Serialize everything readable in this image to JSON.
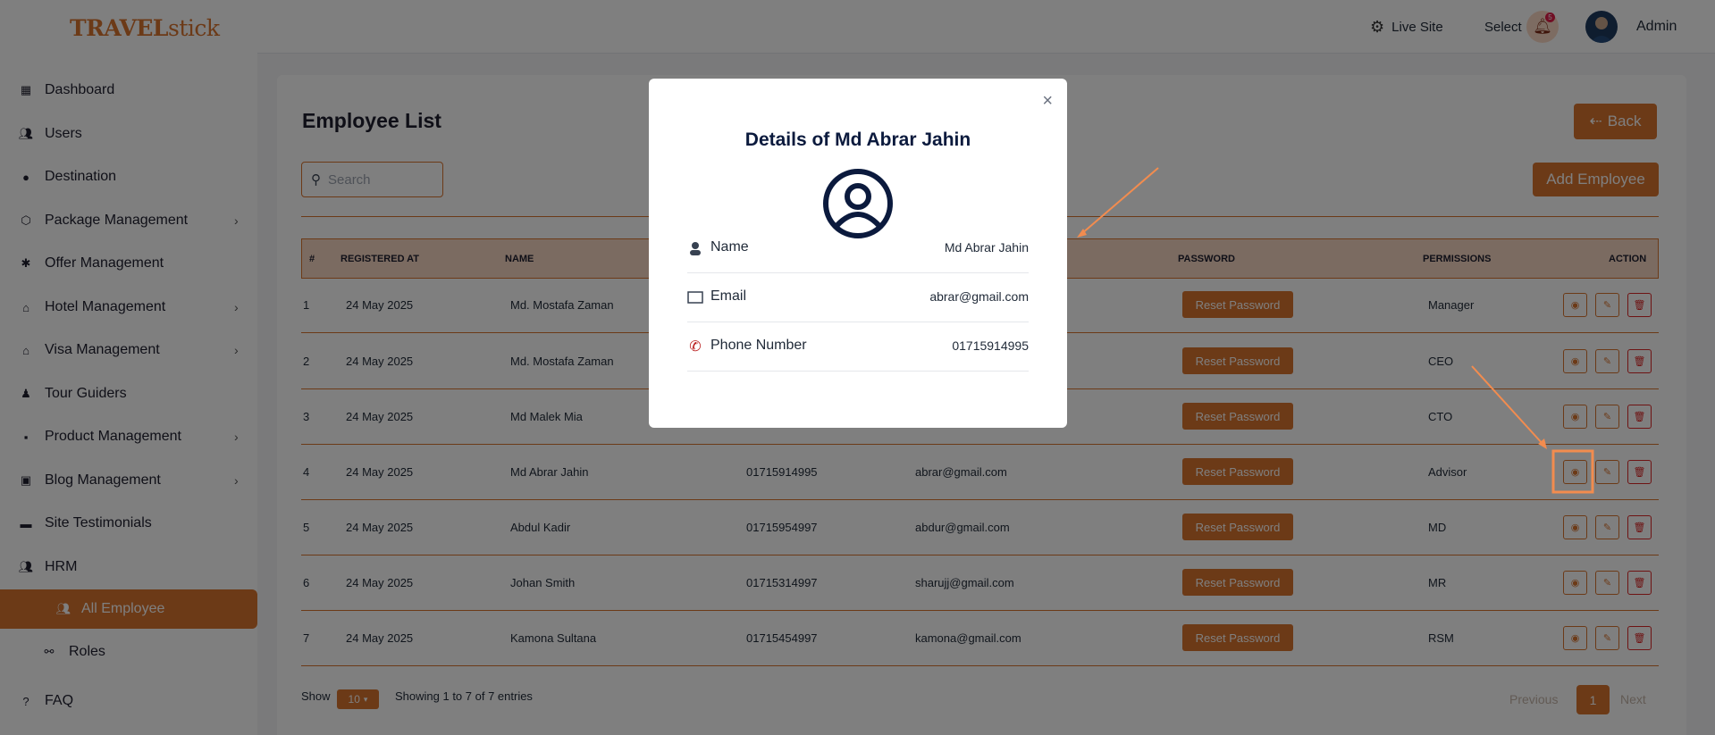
{
  "brand": {
    "logo_text": "TRAVEL",
    "logo_text2": "stick"
  },
  "sidebar": {
    "items": [
      {
        "label": "Dashboard",
        "icon": "dashboard-icon"
      },
      {
        "label": "Users",
        "icon": "users-icon"
      },
      {
        "label": "Destination",
        "icon": "location-icon"
      },
      {
        "label": "Package Management",
        "icon": "package-icon",
        "chevron": "›"
      },
      {
        "label": "Offer Management",
        "icon": "offer-icon"
      },
      {
        "label": "Hotel Management",
        "icon": "hotel-icon",
        "chevron": "›"
      },
      {
        "label": "Visa Management",
        "icon": "visa-icon",
        "chevron": "›"
      },
      {
        "label": "Tour Guiders",
        "icon": "guide-icon"
      },
      {
        "label": "Product Management",
        "icon": "product-icon",
        "chevron": "›"
      },
      {
        "label": "Blog Management",
        "icon": "blog-icon",
        "chevron": "›"
      },
      {
        "label": "Site Testimonials",
        "icon": "testimonial-icon"
      },
      {
        "label": "HRM",
        "icon": "hrm-icon"
      },
      {
        "label": "All Employee",
        "icon": "employees-icon"
      },
      {
        "label": "Roles",
        "icon": "roles-icon"
      },
      {
        "label": "FAQ",
        "icon": "faq-icon"
      }
    ]
  },
  "header": {
    "live_site": "Live Site",
    "select": "Select",
    "notification_count": "5",
    "user": "Admin"
  },
  "page": {
    "title": "Employee List",
    "back_label": "Back",
    "search_placeholder": "Search",
    "add_label": "Add Employee"
  },
  "table": {
    "headers": [
      "#",
      "REGISTERED AT",
      "NAME",
      "PASSWORD",
      "PERMISSIONS",
      "ACTION"
    ],
    "reset_label": "Reset Password",
    "rows": [
      {
        "no": "1",
        "date": "24 May 2025",
        "name": "Md. Mostafa Zaman",
        "phone": "",
        "email": "",
        "permission": "Manager"
      },
      {
        "no": "2",
        "date": "24 May 2025",
        "name": "Md. Mostafa Zaman",
        "phone": "",
        "email": "",
        "permission": "CEO"
      },
      {
        "no": "3",
        "date": "24 May 2025",
        "name": "Md Malek Mia",
        "phone": "",
        "email": "",
        "permission": "CTO"
      },
      {
        "no": "4",
        "date": "24 May 2025",
        "name": "Md Abrar Jahin",
        "phone": "01715914995",
        "email": "abrar@gmail.com",
        "permission": "Advisor"
      },
      {
        "no": "5",
        "date": "24 May 2025",
        "name": "Abdul Kadir",
        "phone": "01715954997",
        "email": "abdur@gmail.com",
        "permission": "MD"
      },
      {
        "no": "6",
        "date": "24 May 2025",
        "name": "Johan Smith",
        "phone": "01715314997",
        "email": "sharujj@gmail.com",
        "permission": "MR"
      },
      {
        "no": "7",
        "date": "24 May 2025",
        "name": "Kamona Sultana",
        "phone": "01715454997",
        "email": "kamona@gmail.com",
        "permission": "RSM"
      }
    ]
  },
  "footer": {
    "show": "Show",
    "page_size": "10",
    "entries": "Showing 1 to 7 of 7 entries",
    "previous": "Previous",
    "page": "1",
    "next": "Next"
  },
  "modal": {
    "title": "Details of Md Abrar Jahin",
    "close": "×",
    "fields": [
      {
        "label": "Name",
        "value": "Md Abrar Jahin",
        "icon": "person-icon"
      },
      {
        "label": "Email",
        "value": "abrar@gmail.com",
        "icon": "email-icon"
      },
      {
        "label": "Phone Number",
        "value": "01715914995",
        "icon": "phone-icon"
      }
    ]
  },
  "colors": {
    "accent": "#d9742f",
    "danger": "#dc2626",
    "navy": "#0b1a3d"
  }
}
